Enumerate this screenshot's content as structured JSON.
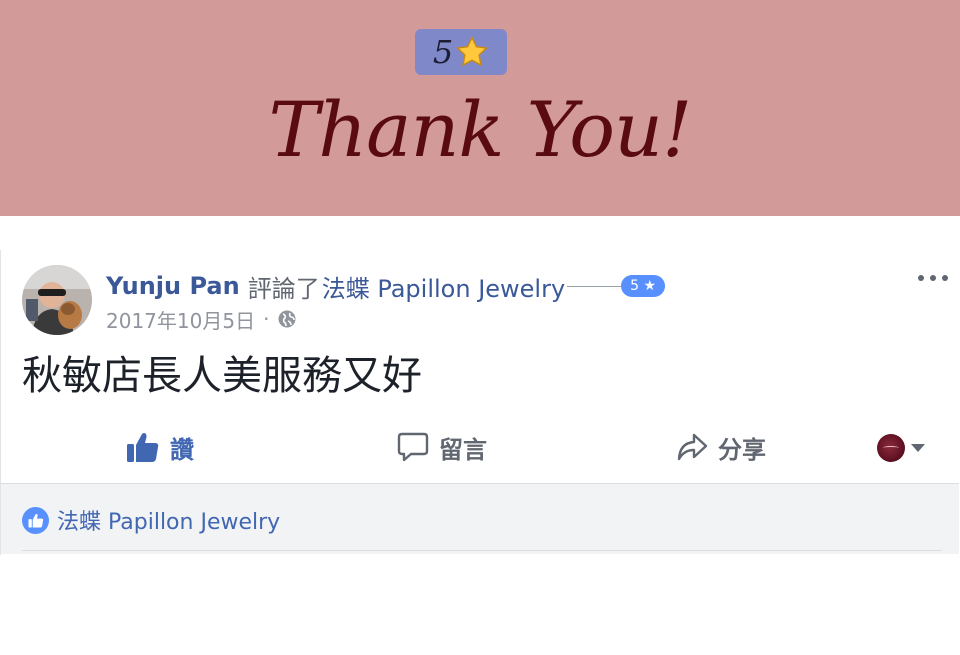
{
  "banner": {
    "rating_number": "5",
    "star_icon": "star-icon",
    "title": "Thank You!",
    "background_color": "#d29b9a",
    "badge_color": "#7f89c9"
  },
  "post": {
    "author": "Yunju Pan",
    "verb": "評論了",
    "page_name": "法蝶 Papillon Jewelry",
    "rating_chip": "5 ★",
    "date": "2017年10月5日",
    "separator": "·",
    "privacy_icon": "globe-icon",
    "body": "秋敏店長人美服務又好"
  },
  "actions": {
    "like_label": "讚",
    "comment_label": "留言",
    "share_label": "分享"
  },
  "footer": {
    "liked_by": "法蝶 Papillon Jewelry"
  },
  "colors": {
    "link_blue": "#3b5998",
    "like_blue": "#4267b2",
    "chip_blue": "#5890ff",
    "title_red": "#5a0b10"
  }
}
